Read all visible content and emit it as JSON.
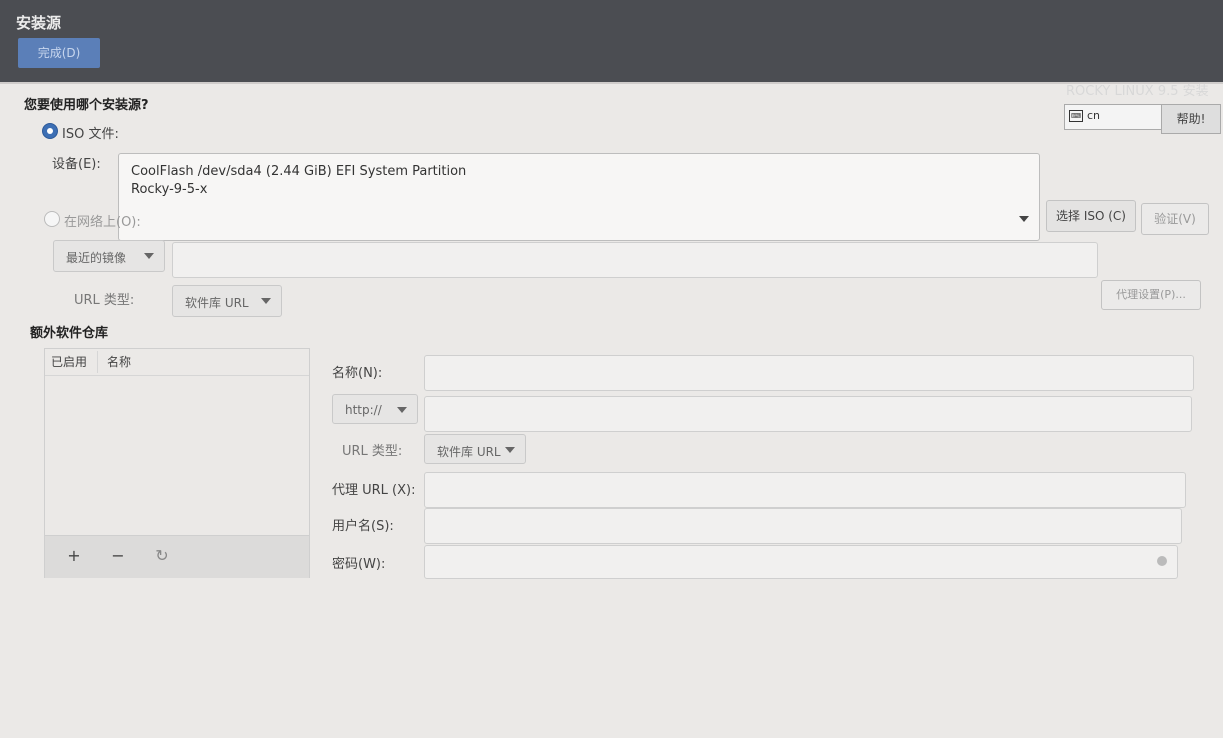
{
  "header": {
    "title": "安装源",
    "done_button": "完成(D)",
    "brand": "ROCKY LINUX 9.5 安装",
    "keyboard_layout": "cn",
    "help_button": "帮助!"
  },
  "source": {
    "question": "您要使用哪个安装源?",
    "iso_option": "ISO 文件:",
    "device_label": "设备(E):",
    "device_line1": "CoolFlash /dev/sda4 (2.44 GiB) EFI System Partition",
    "device_line2": "Rocky-9-5-x",
    "choose_iso_button": "选择 ISO (C)",
    "verify_button": "验证(V)",
    "network_option": "在网络上(O):",
    "mirror_dropdown": "最近的镜像",
    "url_type_label": "URL 类型:",
    "url_type_value": "软件库 URL",
    "proxy_button": "代理设置(P)..."
  },
  "extra_repos": {
    "title": "额外软件仓库",
    "columns": [
      "已启用",
      "名称"
    ],
    "add": "+",
    "remove": "−",
    "reset": "↻",
    "name_label": "名称(N):",
    "protocol": "http://",
    "url_type_label": "URL 类型:",
    "url_type_value": "软件库 URL",
    "proxy_url_label": "代理 URL (X):",
    "username_label": "用户名(S):",
    "password_label": "密码(W):"
  },
  "colors": {
    "accent": "#3d6fb4",
    "header_bg": "#4b4d52",
    "panel_bg": "#ebe9e7"
  }
}
